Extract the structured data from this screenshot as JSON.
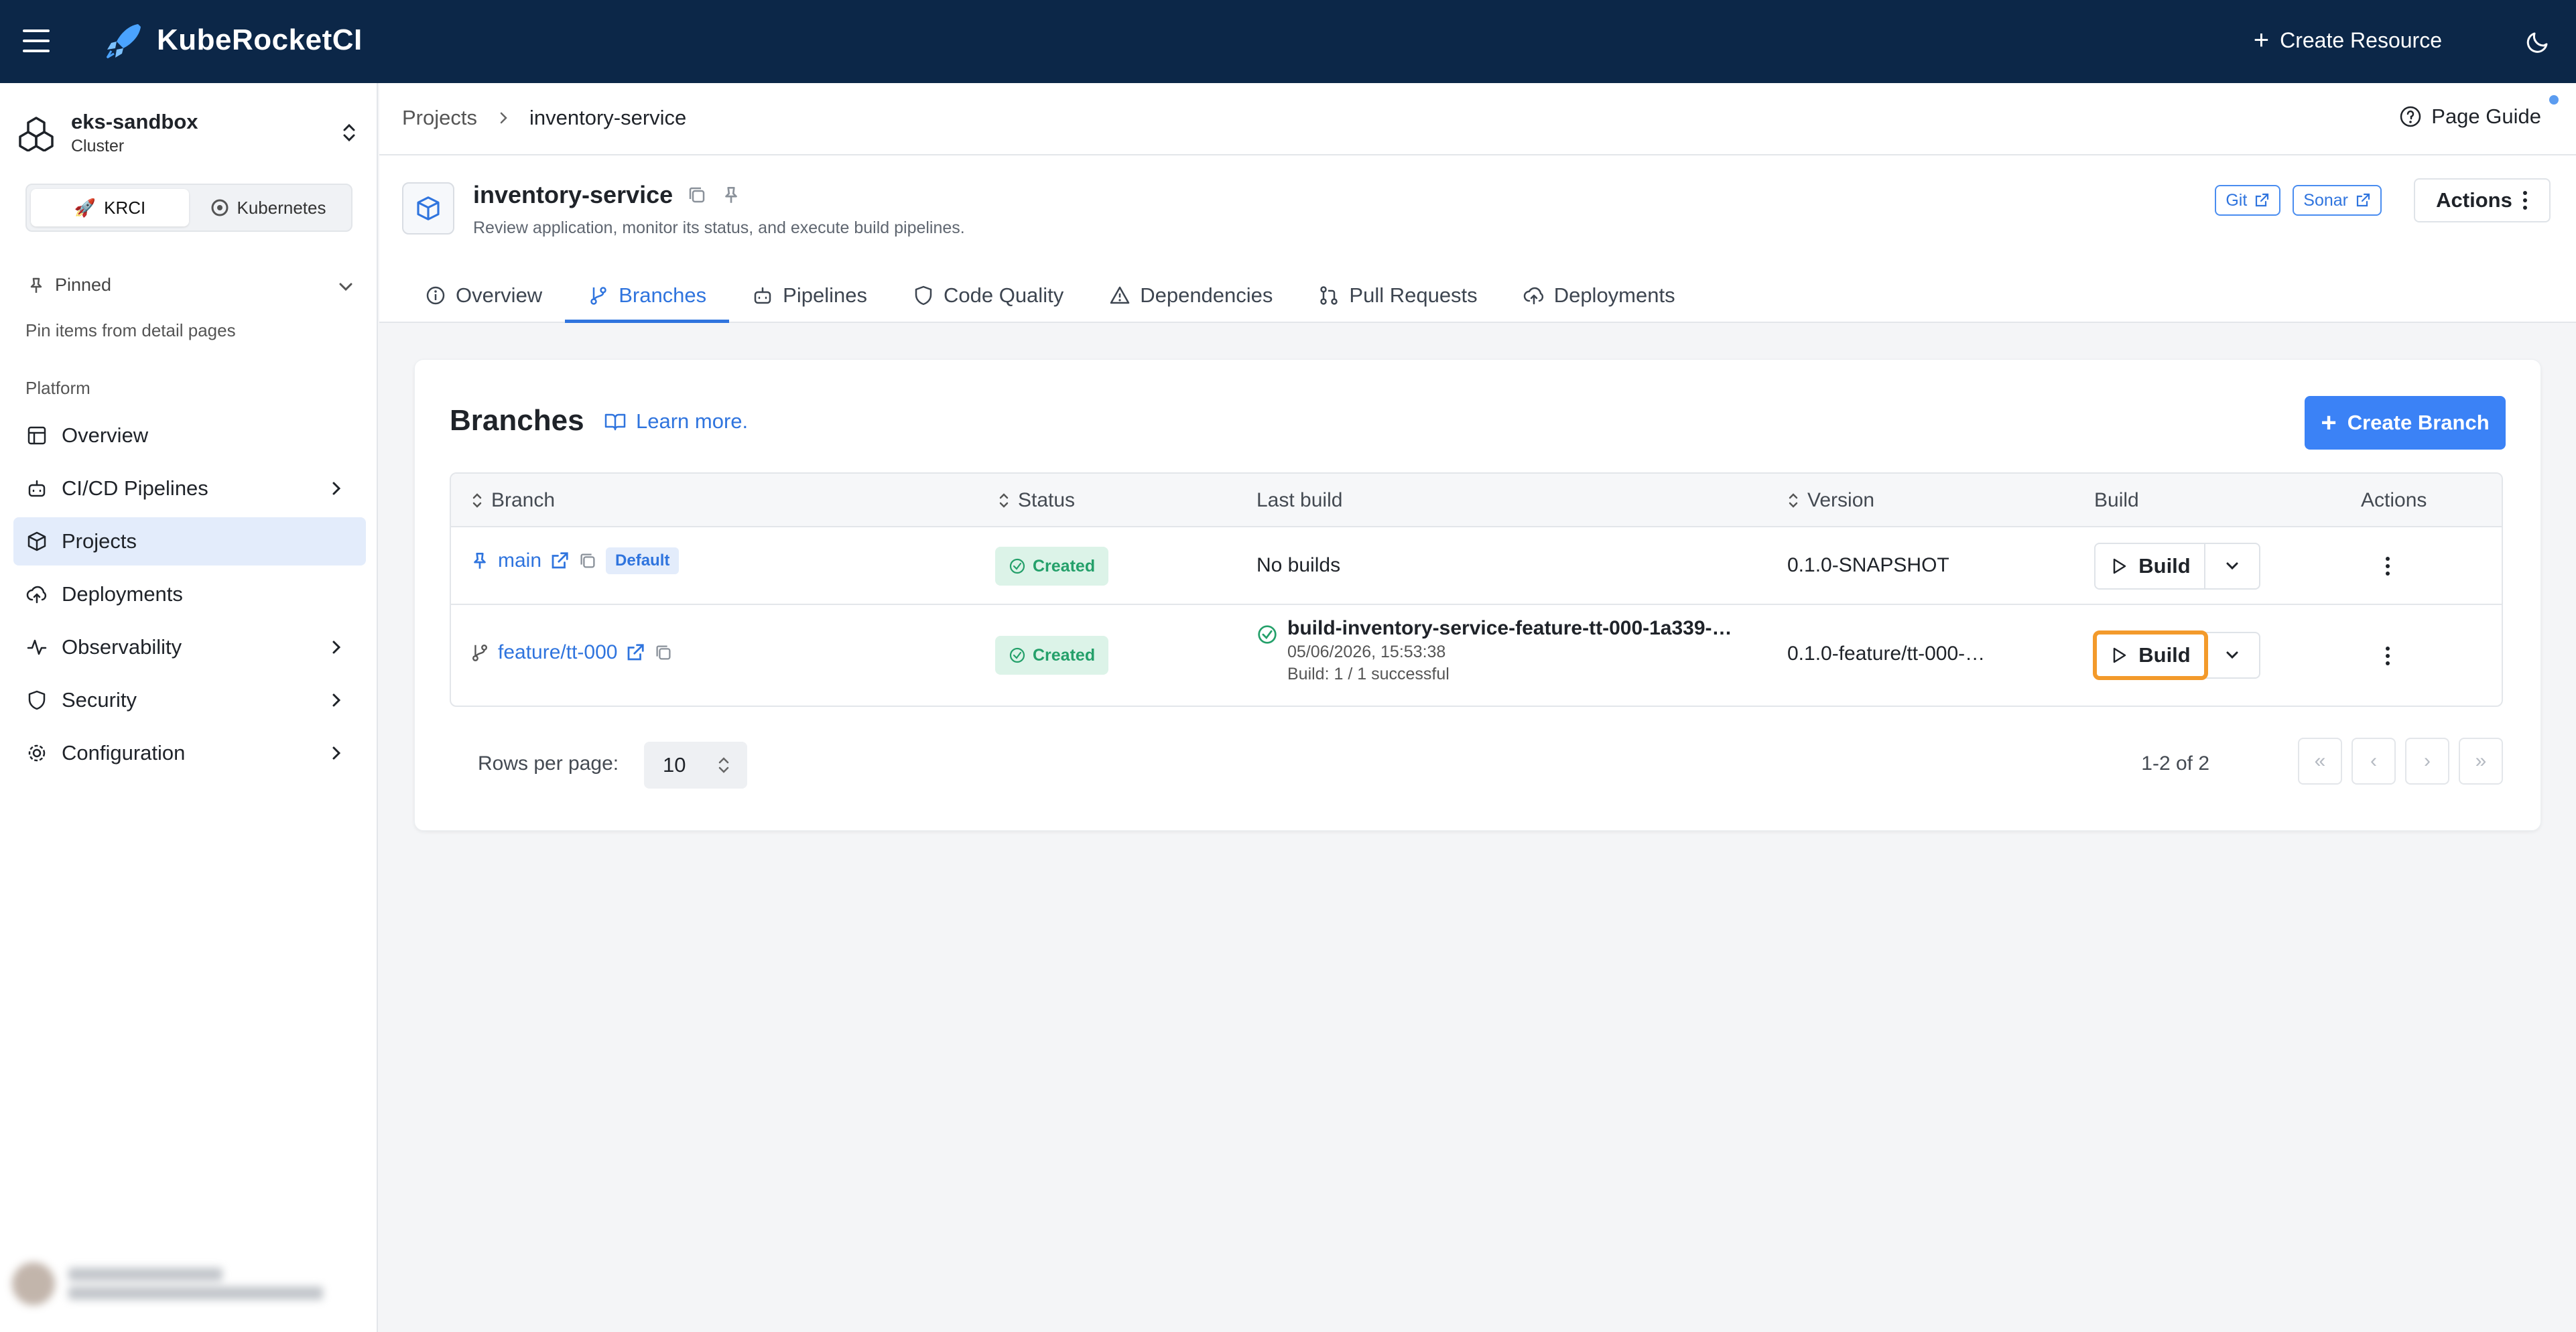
{
  "app": {
    "name": "KubeRocketCI",
    "create_resource": "Create Resource"
  },
  "cluster": {
    "name": "eks-sandbox",
    "type": "Cluster"
  },
  "mode": {
    "krci": "KRCI",
    "kubernetes": "Kubernetes",
    "selected": "KRCI"
  },
  "pinned": {
    "label": "Pinned",
    "hint": "Pin items from detail pages"
  },
  "platform": {
    "label": "Platform",
    "items": [
      {
        "label": "Overview",
        "icon": "layout-icon",
        "expandable": false
      },
      {
        "label": "CI/CD Pipelines",
        "icon": "bot-icon",
        "expandable": true
      },
      {
        "label": "Projects",
        "icon": "box-icon",
        "expandable": false,
        "active": true
      },
      {
        "label": "Deployments",
        "icon": "cloud-upload-icon",
        "expandable": false
      },
      {
        "label": "Observability",
        "icon": "activity-icon",
        "expandable": true
      },
      {
        "label": "Security",
        "icon": "shield-icon",
        "expandable": true
      },
      {
        "label": "Configuration",
        "icon": "gear-icon",
        "expandable": true
      }
    ]
  },
  "breadcrumb": {
    "parent": "Projects",
    "current": "inventory-service"
  },
  "page_guide": "Page Guide",
  "project": {
    "name": "inventory-service",
    "description": "Review application, monitor its status, and execute build pipelines.",
    "links": {
      "git": "Git",
      "sonar": "Sonar"
    },
    "actions": "Actions"
  },
  "tabs": [
    {
      "label": "Overview",
      "icon": "info-icon"
    },
    {
      "label": "Branches",
      "icon": "git-branch-icon",
      "active": true
    },
    {
      "label": "Pipelines",
      "icon": "bot-icon"
    },
    {
      "label": "Code Quality",
      "icon": "shield-icon"
    },
    {
      "label": "Dependencies",
      "icon": "warning-icon"
    },
    {
      "label": "Pull Requests",
      "icon": "git-pull-request-icon"
    },
    {
      "label": "Deployments",
      "icon": "cloud-upload-icon"
    }
  ],
  "branches": {
    "title": "Branches",
    "learn_more": "Learn more.",
    "create_button": "Create Branch",
    "columns": {
      "branch": "Branch",
      "status": "Status",
      "last_build": "Last build",
      "version": "Version",
      "build": "Build",
      "actions": "Actions"
    },
    "rows": [
      {
        "name": "main",
        "default_badge": "Default",
        "status": "Created",
        "last_build": "No builds",
        "version": "0.1.0-SNAPSHOT",
        "build_label": "Build"
      },
      {
        "name": "feature/tt-000",
        "status": "Created",
        "last_build_name": "build-inventory-service-feature-tt-000-1a339-…",
        "last_build_time": "05/06/2026, 15:53:38",
        "last_build_summary": "Build: 1 / 1 successful",
        "version": "0.1.0-feature/tt-000-…",
        "build_label": "Build"
      }
    ],
    "pagination": {
      "rows_label": "Rows per page:",
      "rows_value": "10",
      "range": "1-2 of 2"
    }
  },
  "colors": {
    "topbar": "#0c2748",
    "accent": "#3b82f6",
    "success": "#24a06a",
    "highlight": "#f39a2b"
  }
}
